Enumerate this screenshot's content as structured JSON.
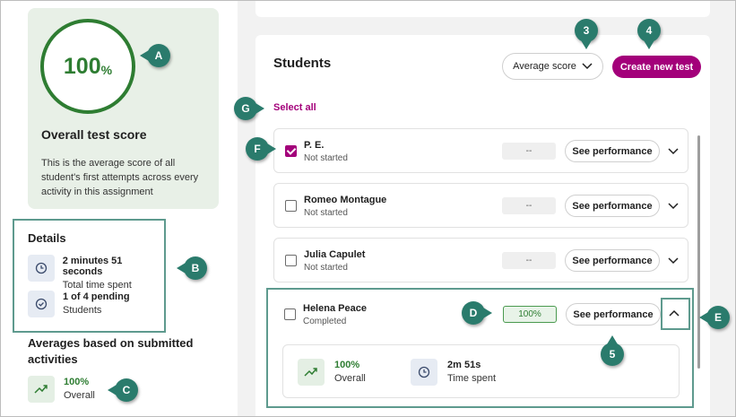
{
  "overall": {
    "score_value": "100",
    "score_unit": "%",
    "title": "Overall test score",
    "description": "This is the average score of all student's first attempts across every activity in this assignment"
  },
  "details": {
    "title": "Details",
    "time_main": "2 minutes 51 seconds",
    "time_sub": "Total time spent",
    "pending_main": "1 of 4 pending",
    "pending_sub": "Students"
  },
  "averages": {
    "title": "Averages based on submitted activities",
    "value": "100%",
    "label": "Overall"
  },
  "students": {
    "title": "Students",
    "sort_label": "Average score",
    "create_label": "Create new test",
    "select_all": "Select all",
    "rows": [
      {
        "name": "P. E.",
        "status": "Not started",
        "score": "--",
        "checked": true
      },
      {
        "name": "Romeo Montague",
        "status": "Not started",
        "score": "--",
        "checked": false
      },
      {
        "name": "Julia Capulet",
        "status": "Not started",
        "score": "--",
        "checked": false
      },
      {
        "name": "Helena Peace",
        "status": "Completed",
        "score": "100%",
        "checked": false
      }
    ],
    "perf_label": "See performance",
    "expanded": {
      "score_value": "100%",
      "score_label": "Overall",
      "time_value": "2m 51s",
      "time_label": "Time spent"
    }
  },
  "callouts": {
    "a": "A",
    "b": "B",
    "c": "C",
    "d": "D",
    "e": "E",
    "f": "F",
    "g": "G",
    "n3": "3",
    "n4": "4",
    "n5": "5"
  },
  "colors": {
    "accent": "#a3007a",
    "success": "#2e7d32",
    "callout": "#2a7b6c",
    "highlight_border": "#5e9a8e"
  }
}
